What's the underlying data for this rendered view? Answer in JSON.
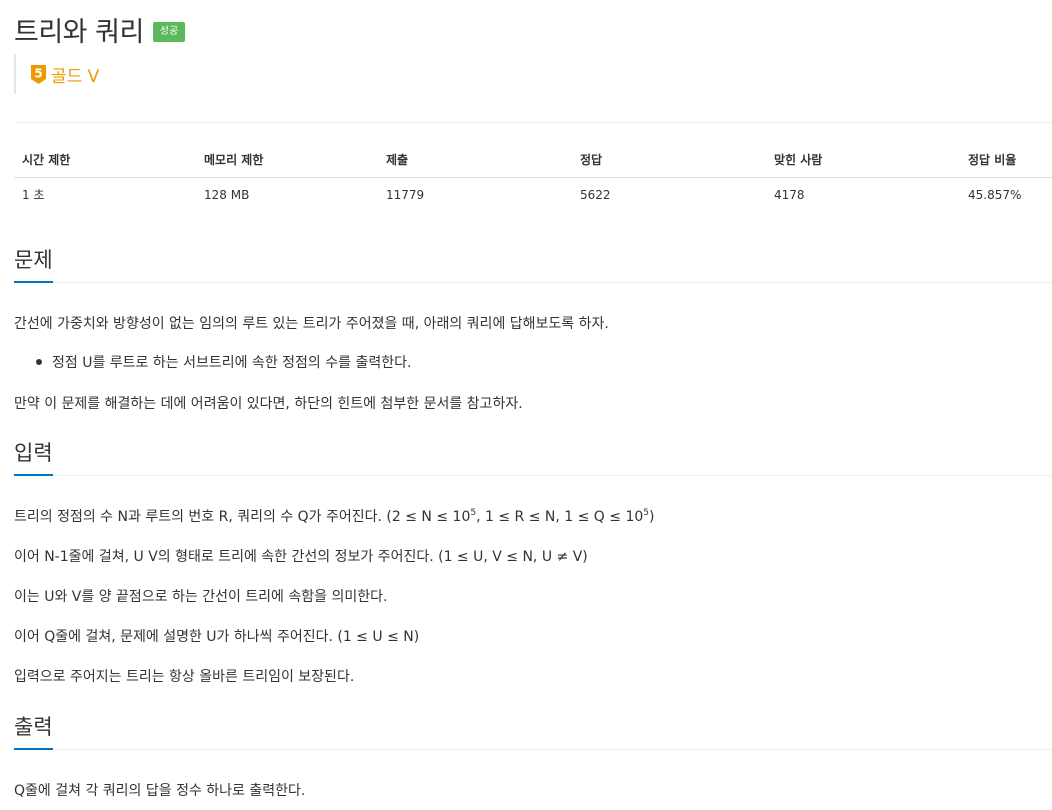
{
  "problem": {
    "title": "트리와 쿼리",
    "status": "성공",
    "tier_num": "5",
    "tier_label": "골드 V"
  },
  "info_table": {
    "headers": [
      "시간 제한",
      "메모리 제한",
      "제출",
      "정답",
      "맞힌 사람",
      "정답 비율"
    ],
    "values": [
      "1 초",
      "128 MB",
      "11779",
      "5622",
      "4178",
      "45.857%"
    ]
  },
  "sections": {
    "description": {
      "title": "문제",
      "p1": "간선에 가중치와 방향성이 없는 임의의 루트 있는 트리가 주어졌을 때, 아래의 쿼리에 답해보도록 하자.",
      "bullet1": "정점 U를 루트로 하는 서브트리에 속한 정점의 수를 출력한다.",
      "p2": "만약 이 문제를 해결하는 데에 어려움이 있다면, 하단의 힌트에 첨부한 문서를 참고하자."
    },
    "input": {
      "title": "입력",
      "line1_a": "트리의 정점의 수 N과 루트의 번호 R, 쿼리의 수 Q가 주어진다. (2 ≤ N ≤ 10",
      "line1_sup1": "5",
      "line1_b": ", 1 ≤ R ≤ N, 1 ≤ Q ≤ 10",
      "line1_sup2": "5",
      "line1_c": ")",
      "line2": "이어 N-1줄에 걸쳐, U V의 형태로 트리에 속한 간선의 정보가 주어진다. (1 ≤ U, V ≤ N, U ≠ V)",
      "line3": "이는 U와 V를 양 끝점으로 하는 간선이 트리에 속함을 의미한다.",
      "line4": "이어 Q줄에 걸쳐, 문제에 설명한 U가 하나씩 주어진다. (1 ≤ U ≤ N)",
      "line5": "입력으로 주어지는 트리는 항상 올바른 트리임이 보장된다."
    },
    "output": {
      "title": "출력",
      "line1": "Q줄에 걸쳐 각 쿼리의 답을 정수 하나로 출력한다."
    }
  },
  "colors": {
    "accent": "#0076c0",
    "success": "#5cb85c",
    "gold_tier": "#ec9a00"
  }
}
